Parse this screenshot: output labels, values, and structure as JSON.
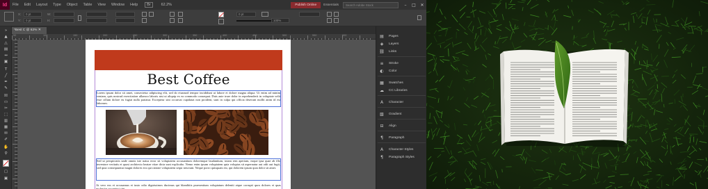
{
  "app": {
    "logo": "Id",
    "menu": [
      "File",
      "Edit",
      "Layout",
      "Type",
      "Object",
      "Table",
      "View",
      "Window",
      "Help"
    ],
    "zoom": "62.2%",
    "workspace_button": "Publish Online",
    "workspace_name": "Essentials",
    "search_placeholder": "Search Adobe Stock"
  },
  "control_bar": {
    "x_label": "X:",
    "y_label": "Y:",
    "w_label": "W:",
    "h_label": "H:",
    "x_value": "0 pt",
    "y_value": "0 pt",
    "w_value": "",
    "h_value": "",
    "stroke_weight": "0 pt",
    "opacity": "100%"
  },
  "document": {
    "tab_label": "*Best C @ 62% ✕",
    "title": "Best Coffee",
    "paragraph_1": "Lorem ipsum dolor sit amet, consectetur adipiscing elit, sed do eiusmod tempor incididunt ut labore et dolore magna aliqua. Ut enim ad minim veniam, quis nostrud exercitation ullamco laboris nisi ut aliquip ex ea commodo consequat. Duis aute irure dolor in reprehenderit in voluptate velit esse cillum dolore eu fugiat nulla pariatur. Excepteur sint occaecat cupidatat non proident, sunt in culpa qui officia deserunt mollit anim id est laborum.",
    "paragraph_2": "Sed ut perspiciatis unde omnis iste natus error sit voluptatem accusantium doloremque laudantium, totam rem aperiam, eaque ipsa quae ab illo inventore veritatis et quasi architecto beatae vitae dicta sunt explicabo. Nemo enim ipsam voluptatem quia voluptas sit aspernatur aut odit aut fugit, sed quia consequuntur magni dolores eos qui ratione voluptatem sequi nesciunt. Neque porro quisquam est, qui dolorem ipsum quia dolor sit amet.",
    "paragraph_3": "At vero eos et accusamus et iusto odio dignissimos ducimus qui blanditiis praesentium voluptatum deleniti atque corrupti quos dolores et quas molestias excepturi sint."
  },
  "ruler": {
    "labels": [
      "50",
      "100",
      "150",
      "200",
      "250",
      "300",
      "350",
      "400",
      "450",
      "500",
      "550",
      "600"
    ]
  },
  "panels": [
    {
      "icon": "pages-icon",
      "label": "Pages"
    },
    {
      "icon": "layers-icon",
      "label": "Layers"
    },
    {
      "icon": "links-icon",
      "label": "Links"
    },
    {
      "icon": "stroke-icon",
      "label": "Stroke"
    },
    {
      "icon": "color-icon",
      "label": "Color"
    },
    {
      "icon": "swatches-icon",
      "label": "Swatches"
    },
    {
      "icon": "cc-libraries-icon",
      "label": "CC Libraries"
    },
    {
      "icon": "character-icon",
      "label": "Character"
    },
    {
      "icon": "gradient-icon",
      "label": "Gradient"
    },
    {
      "icon": "align-icon",
      "label": "Align"
    },
    {
      "icon": "paragraph-icon",
      "label": "Paragraph"
    },
    {
      "icon": "character-styles-icon",
      "label": "Character Styles"
    },
    {
      "icon": "paragraph-styles-icon",
      "label": "Paragraph Styles"
    }
  ],
  "colors": {
    "header_bar": "#c03a1c",
    "frame_outline": "#4a6fd8",
    "margin_guide": "#b48ad8",
    "workspace_button": "#8a2a2e"
  }
}
